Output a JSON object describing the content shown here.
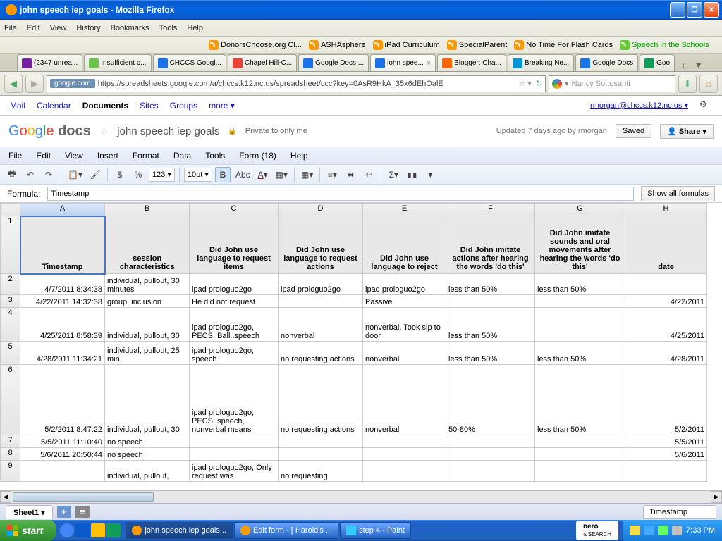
{
  "window": {
    "title": "john speech iep goals - Mozilla Firefox"
  },
  "ff_menu": [
    "File",
    "Edit",
    "View",
    "History",
    "Bookmarks",
    "Tools",
    "Help"
  ],
  "bookmarks": [
    "DonorsChoose.org Cl...",
    "ASHAsphere",
    "iPad Curriculum",
    "SpecialParent",
    "No Time For Flash Cards",
    "Speech in the Schools"
  ],
  "tabs": [
    {
      "label": "(2347 unrea...",
      "color": "#7a1fa2"
    },
    {
      "label": "Insufficient p...",
      "color": "#6cc24a"
    },
    {
      "label": "CHCCS Googl...",
      "color": "#1a73e8"
    },
    {
      "label": "Chapel Hill-C...",
      "color": "#ea4335"
    },
    {
      "label": "Google Docs ...",
      "color": "#1a73e8"
    },
    {
      "label": "john spee...",
      "color": "#1a73e8",
      "active": true
    },
    {
      "label": "Blogger: Cha...",
      "color": "#ff6600"
    },
    {
      "label": "Breaking Ne...",
      "color": "#0096d6"
    },
    {
      "label": "Google Docs",
      "color": "#1a73e8"
    },
    {
      "label": "Goo",
      "color": "#0f9d58"
    }
  ],
  "url": {
    "host": "google.com",
    "full": "https://spreadsheets.google.com/a/chccs.k12.nc.us/spreadsheet/ccc?key=0AsR9HkA_35x6dEhOalE"
  },
  "search": {
    "engine": "Nancy Sottosanti"
  },
  "gdocs": {
    "nav": [
      "Mail",
      "Calendar",
      "Documents",
      "Sites",
      "Groups",
      "more ▾"
    ],
    "email": "rmorgan@chccs.k12.nc.us ▾",
    "docname": "john speech iep goals",
    "privacy": "Private to only me",
    "updated": "Updated 7 days ago by rmorgan",
    "saved": "Saved",
    "share": "Share ▾",
    "menu": [
      "File",
      "Edit",
      "View",
      "Insert",
      "Format",
      "Data",
      "Tools",
      "Form (18)",
      "Help"
    ],
    "fontsize": "10pt ▾",
    "numfmt": "123 ▾",
    "formula_label": "Formula:",
    "formula_value": "Timestamp",
    "show_formulas": "Show all formulas"
  },
  "badge_lock": "🔒",
  "chart_data": {
    "type": "table",
    "columns": [
      "A",
      "B",
      "C",
      "D",
      "E",
      "F",
      "G",
      "H"
    ],
    "headers": [
      "Timestamp",
      "session characteristics",
      "Did John use language to request items",
      "Did John use language to request actions",
      "Did John use language to reject",
      "Did John imitate actions after hearing the words 'do this'",
      "Did John imitate sounds and oral movements after hearing the words 'do this'",
      "date"
    ],
    "rows": [
      [
        "4/7/2011 8:34:38",
        "individual, pullout, 30 minutes",
        "ipad prologuo2go",
        "ipad prologuo2go",
        "ipad prologuo2go",
        "less than 50%",
        "less than 50%",
        ""
      ],
      [
        "4/22/2011 14:32:38",
        "group, inclusion",
        "He did not request",
        "",
        "Passive",
        "",
        "",
        "4/22/2011"
      ],
      [
        "4/25/2011 8:58:39",
        "individual, pullout, 30",
        "ipad prologuo2go, PECS, Ball..speech",
        "nonverbal",
        "nonverbal, Took slp to door",
        "less than 50%",
        "",
        "4/25/2011"
      ],
      [
        "4/28/2011 11:34:21",
        "individual, pullout, 25 min",
        "ipad prologuo2go, speech",
        "no requesting actions",
        "nonverbal",
        "less than 50%",
        "less than 50%",
        "4/28/2011"
      ],
      [
        "5/2/2011 8:47:22",
        "individual, pullout, 30",
        "ipad prologuo2go, PECS, speech, nonverbal means",
        "no requesting actions",
        "nonverbal",
        "50-80%",
        "less than 50%",
        "5/2/2011"
      ],
      [
        "5/5/2011 11:10:40",
        "no speech",
        "",
        "",
        "",
        "",
        "",
        "5/5/2011"
      ],
      [
        "5/6/2011 20:50:44",
        "no speech",
        "",
        "",
        "",
        "",
        "",
        "5/6/2011"
      ],
      [
        "",
        "individual, pullout,",
        "ipad prologuo2go, Only request was",
        "no requesting",
        "",
        "",
        "",
        ""
      ]
    ]
  },
  "sheet_tab": "Sheet1 ▾",
  "status_cell": "Timestamp",
  "taskbar": {
    "start": "start",
    "tasks": [
      "john speech iep goals...",
      "Edit form - [ Harold's ...",
      "step 4 - Paint"
    ],
    "nero": "nero",
    "time": "7:33 PM"
  }
}
